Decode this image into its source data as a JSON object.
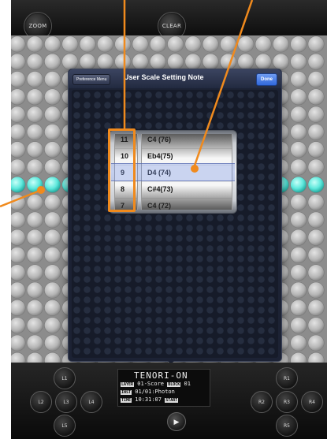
{
  "top_bar": {
    "zoom_label": "ZOOM",
    "clear_label": "CLEAR"
  },
  "modal": {
    "back_label": "Preference Menu",
    "title": "User Scale Setting Note",
    "done_label": "Done"
  },
  "picker": {
    "numbers": [
      "11",
      "10",
      "9",
      "8",
      "7"
    ],
    "notes": [
      "C4 (76)",
      "Eb4(75)",
      "D4 (74)",
      "C#4(73)",
      "C4 (72)"
    ],
    "selected_index": 2
  },
  "panel": {
    "buttons": {
      "l1": "L1",
      "l2": "L2",
      "l3": "L3",
      "l4": "L4",
      "l5": "L5",
      "r1": "R1",
      "r2": "R2",
      "r3": "R3",
      "r4": "R4",
      "r5": "R5"
    },
    "lcd": {
      "brand": "TENORI-ON",
      "layer_tag": "LAYER",
      "layer_value": "01-Score",
      "block_tag": "BLOCK",
      "block_value": "01",
      "inst_tag": "INST",
      "inst_value": "01/01:Photon",
      "time_tag": "TIME",
      "time_value": "10:31:07",
      "start_tag": "START"
    },
    "play_icon": "play-icon"
  },
  "colors": {
    "accent_orange": "#f08a1d",
    "lit_led": "#5ee8dc",
    "done_blue": "#3a75e0"
  }
}
